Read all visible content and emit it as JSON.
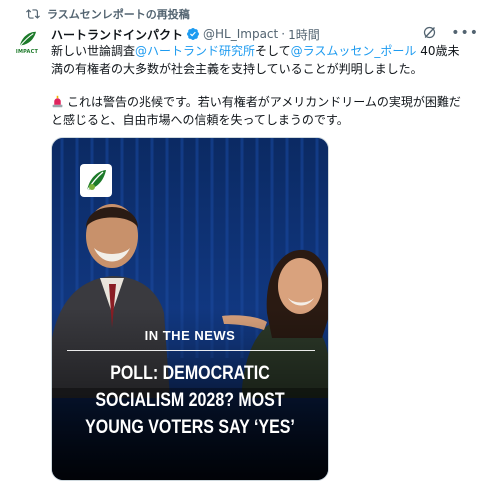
{
  "repost": {
    "text": "ラスムセンレポートの再投稿"
  },
  "avatar": {
    "text": "IMPACT"
  },
  "author": {
    "name": "ハートランドインパクト",
    "handle": "@HL_Impact",
    "separator": "·",
    "time": "1時間"
  },
  "tweet": {
    "line1": {
      "pre": "新しい世論調査",
      "mention1": "@ハートランド研究所",
      "mid": "そして",
      "mention2": "@ラスムッセン_ポール",
      "post": " 40歳未"
    },
    "line2": "満の有権者の大多数が社会主義を支持していることが判明しました。",
    "line3": "これは警告の兆候です。若い有権者がアメリカンドリームの実現が困難だ",
    "line4": "と感じると、自由市場への信頼を失ってしまうのです。"
  },
  "media": {
    "label": "IN THE NEWS",
    "headline": [
      "POLL: DEMOCRATIC",
      "SOCIALISM 2028? MOST",
      "YOUNG VOTERS SAY ‘YES’"
    ]
  },
  "colors": {
    "accent": "#1d9bf0",
    "text": "#0f1419",
    "muted": "#536471",
    "stage_blue": "#0c2f6a",
    "logo_green": "#1d7a2a"
  },
  "icons": {
    "repost": "repost-icon",
    "verified": "verified-badge-icon",
    "grok": "grok-icon",
    "more": "more-icon",
    "siren": "siren-emoji-icon"
  }
}
